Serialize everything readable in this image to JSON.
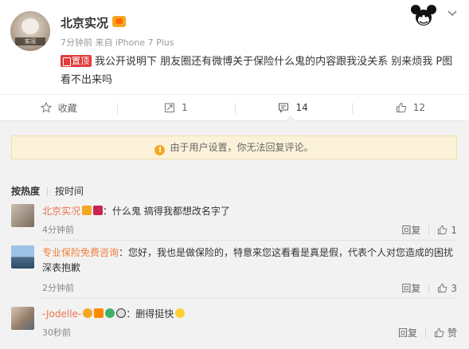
{
  "post": {
    "author": "北京实况",
    "avatar_label": "实况",
    "meta": "7分钟前 来自 iPhone 7 Plus",
    "badge": "置顶",
    "text": "我公开说明下 朋友圈还有微博关于保险什么鬼的内容跟我没关系 别来烦我 P图看不出来吗"
  },
  "actions": {
    "favorite": "收藏",
    "repost": "1",
    "comment": "14",
    "like": "12"
  },
  "notice": "由于用户设置，你无法回复评论。",
  "sort": {
    "hot": "按热度",
    "time": "按时间"
  },
  "comments": [
    {
      "name": "北京实况",
      "text": "：什么鬼 搞得我都想改名字了",
      "time": "4分钟前",
      "reply": "回复",
      "likes": "1"
    },
    {
      "name": "专业保险免费咨询",
      "text": "：您好，我也是做保险的，特意来您这看看是真是假，代表个人对您造成的困扰深表抱歉",
      "time": "2分钟前",
      "reply": "回复",
      "likes": "3"
    },
    {
      "name": "-Jodelle-",
      "text": "：删得挺快",
      "time": "30秒前",
      "reply": "回复",
      "likes": "赞"
    }
  ],
  "colors": {
    "accent": "#eb7350",
    "badge_red": "#e13d3d",
    "notice_bg": "#fcf2d9",
    "section_bg": "#f2f2f2"
  },
  "icons": [
    "star-icon",
    "repost-icon",
    "comment-icon",
    "thumbs-up-icon",
    "chevron-down-icon",
    "warning-icon",
    "mickey-icon",
    "vip-icon"
  ]
}
